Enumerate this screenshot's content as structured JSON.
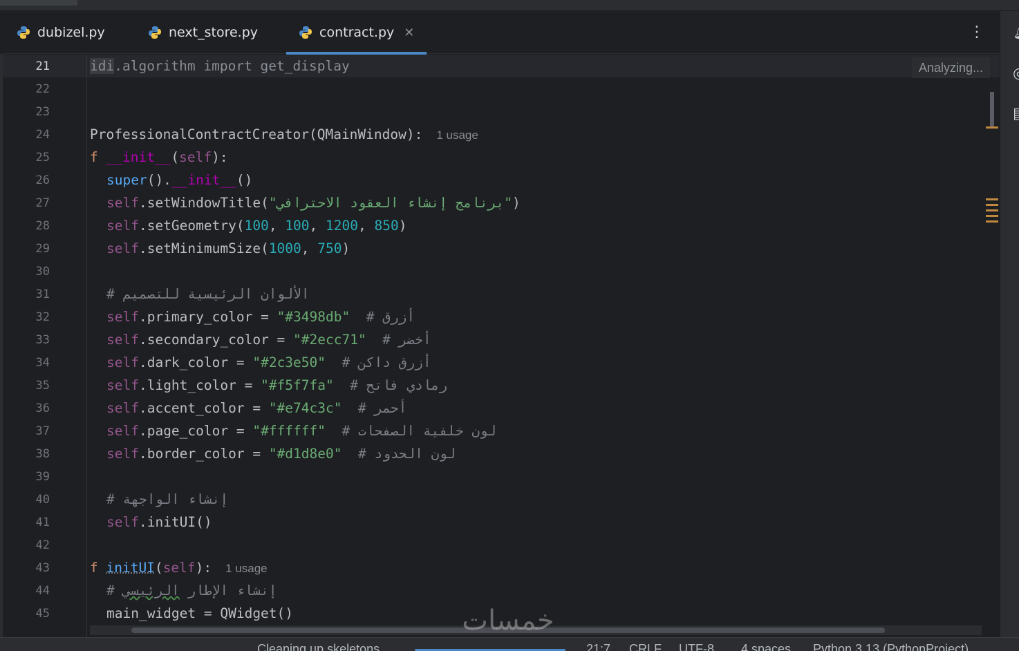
{
  "tabs": [
    {
      "label": "dubizel.py",
      "active": false
    },
    {
      "label": "next_store.py",
      "active": false
    },
    {
      "label": "contract.py",
      "active": true
    }
  ],
  "editor": {
    "analyzing_label": "Analyzing...",
    "current_line": 21,
    "line_numbers": [
      "21",
      "22",
      "23",
      "24",
      "25",
      "26",
      "27",
      "28",
      "29",
      "30",
      "31",
      "32",
      "33",
      "34",
      "35",
      "36",
      "37",
      "38",
      "39",
      "40",
      "41",
      "42",
      "43",
      "44",
      "45"
    ],
    "usage_hint": "1 usage",
    "lines": {
      "l21": {
        "a": "idi",
        "b": ".algorithm import get_display"
      },
      "l24": {
        "a": "ProfessionalContractCreator(QMainWindow):"
      },
      "l25": {
        "kw": "f ",
        "fn": "__init__",
        "p1": "(",
        "self": "self",
        "p2": "):"
      },
      "l26": {
        "fn": "super",
        "p1": "().",
        "dunder": "__init__",
        "p2": "()"
      },
      "l27": {
        "self": "self",
        "m": ".setWindowTitle(",
        "str": "\"برنامج إنشاء العقود الاحترافي\"",
        "p": ")"
      },
      "l28": {
        "self": "self",
        "m": ".setGeometry(",
        "n1": "100",
        "c1": ", ",
        "n2": "100",
        "c2": ", ",
        "n3": "1200",
        "c3": ", ",
        "n4": "850",
        "p": ")"
      },
      "l29": {
        "self": "self",
        "m": ".setMinimumSize(",
        "n1": "1000",
        "c1": ", ",
        "n2": "750",
        "p": ")"
      },
      "l31": {
        "cm": "# الألوان الرئيسية للتصميم"
      },
      "l32": {
        "self": "self",
        "m": ".primary_color = ",
        "str": "\"#3498db\"",
        "cm": "  # أزرق"
      },
      "l33": {
        "self": "self",
        "m": ".secondary_color = ",
        "str": "\"#2ecc71\"",
        "cm": "  # أخضر"
      },
      "l34": {
        "self": "self",
        "m": ".dark_color = ",
        "str": "\"#2c3e50\"",
        "cm": "  # أزرق داكن"
      },
      "l35": {
        "self": "self",
        "m": ".light_color = ",
        "str": "\"#f5f7fa\"",
        "cm": "  # رمادي فاتح"
      },
      "l36": {
        "self": "self",
        "m": ".accent_color = ",
        "str": "\"#e74c3c\"",
        "cm": "  # أحمر"
      },
      "l37": {
        "self": "self",
        "m": ".page_color = ",
        "str": "\"#ffffff\"",
        "cm": "  # لون خلفية الصفحات"
      },
      "l38": {
        "self": "self",
        "m": ".border_color = ",
        "str": "\"#d1d8e0\"",
        "cm": "  # لون الحدود"
      },
      "l40": {
        "cm": "# إنشاء الواجهة"
      },
      "l41": {
        "self": "self",
        "m": ".initUI()"
      },
      "l43": {
        "kw": "f ",
        "fn": "initUI",
        "p1": "(",
        "self": "self",
        "p2": "):"
      },
      "l44": {
        "cmhash": "# ",
        "cm": "إنشاء الإطار ",
        "cmw": "الرئيسي"
      },
      "l45": {
        "a": "main_widget = QWidget()"
      }
    }
  },
  "watermark": "خمسات",
  "statusbar": {
    "task": "Cleaning up skeletons",
    "position": "21:7",
    "line_sep": "CRLF",
    "encoding": "UTF-8",
    "indent": "4 spaces",
    "interpreter": "Python 3.13 (PythonProject)"
  },
  "colors": {
    "background": "#1e1f22",
    "keyword": "#cf8e6d",
    "function": "#56a8f5",
    "dunder": "#b200b2",
    "self": "#94558d",
    "string": "#6aab73",
    "number": "#2aacb8",
    "comment": "#7a7e85",
    "tab_underline": "#4a88c7",
    "marker": "#c08a3e"
  }
}
